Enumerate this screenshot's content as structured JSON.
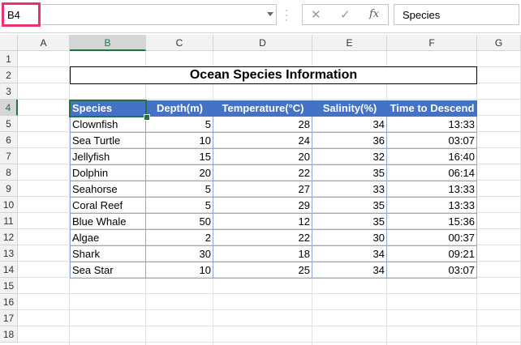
{
  "name_box": {
    "value": "B4"
  },
  "formula_bar": {
    "value": "Species",
    "cancel_icon": "✕",
    "enter_icon": "✓",
    "fx_label": "fx"
  },
  "columns": [
    "A",
    "B",
    "C",
    "D",
    "E",
    "F",
    "G"
  ],
  "rows": [
    "1",
    "2",
    "3",
    "4",
    "5",
    "6",
    "7",
    "8",
    "9",
    "10",
    "11",
    "12",
    "13",
    "14",
    "15",
    "16",
    "17",
    "18"
  ],
  "title": "Ocean Species Information",
  "table": {
    "headers": [
      "Species",
      "Depth(m)",
      "Temperature(°C)",
      "Salinity(%)",
      "Time to Descend"
    ],
    "rows": [
      [
        "Clownfish",
        "5",
        "28",
        "34",
        "13:33"
      ],
      [
        "Sea Turtle",
        "10",
        "24",
        "36",
        "03:07"
      ],
      [
        "Jellyfish",
        "15",
        "20",
        "32",
        "16:40"
      ],
      [
        "Dolphin",
        "20",
        "22",
        "35",
        "06:14"
      ],
      [
        "Seahorse",
        "5",
        "27",
        "33",
        "13:33"
      ],
      [
        "Coral Reef",
        "5",
        "29",
        "35",
        "13:33"
      ],
      [
        "Blue Whale",
        "50",
        "12",
        "35",
        "15:36"
      ],
      [
        "Algae",
        "2",
        "22",
        "30",
        "00:37"
      ],
      [
        "Shark",
        "30",
        "18",
        "34",
        "09:21"
      ],
      [
        "Sea Star",
        "10",
        "25",
        "34",
        "03:07"
      ]
    ]
  },
  "colors": {
    "header_fill": "#4472c4",
    "selection": "#217346",
    "highlight": "#e8336b"
  }
}
